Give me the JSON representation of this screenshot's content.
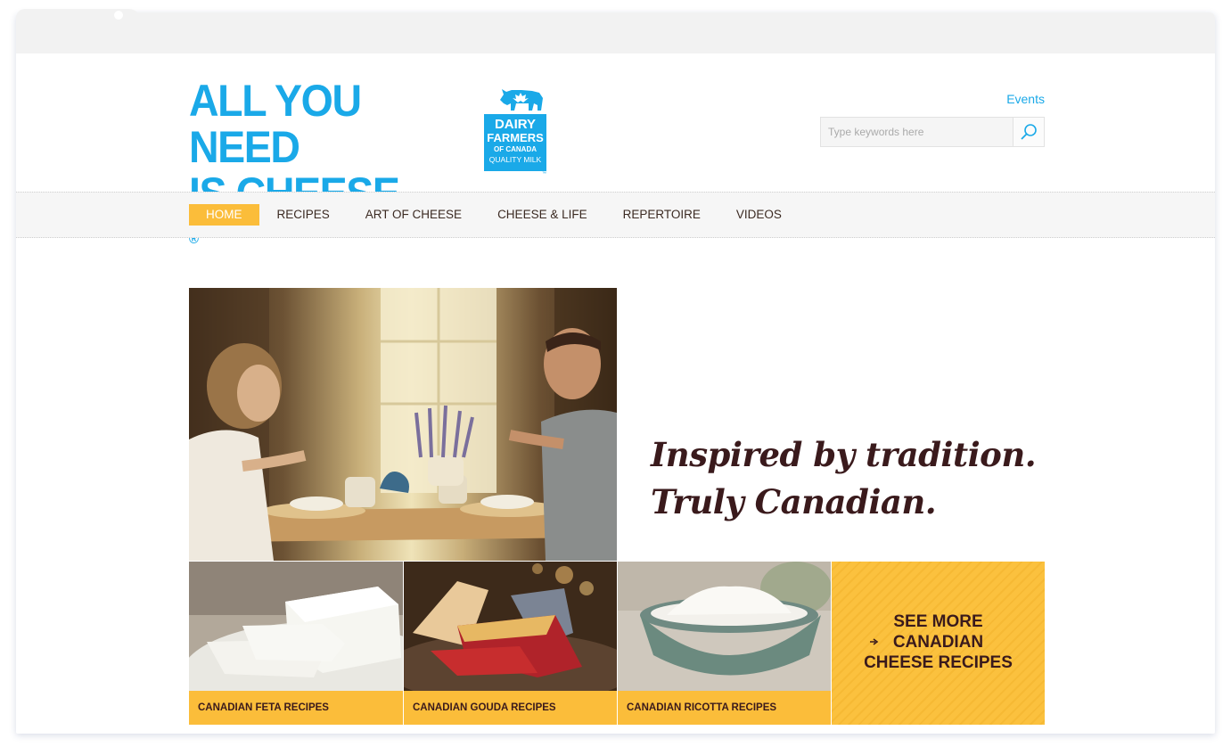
{
  "logo": {
    "line1": "ALL YOU NEED",
    "line2": "IS CHEESE",
    "registered": "®",
    "badge_line1": "DAIRY",
    "badge_line2": "FARMERS",
    "badge_line3": "OF CANADA",
    "badge_line4": "QUALITY MILK",
    "badge_tm": "™"
  },
  "header": {
    "events_link": "Events",
    "search_placeholder": "Type keywords here"
  },
  "nav": {
    "items": [
      {
        "label": "HOME",
        "active": true
      },
      {
        "label": "RECIPES",
        "active": false
      },
      {
        "label": "ART OF CHEESE",
        "active": false
      },
      {
        "label": "CHEESE & LIFE",
        "active": false
      },
      {
        "label": "REPERTOIRE",
        "active": false
      },
      {
        "label": "VIDEOS",
        "active": false
      }
    ]
  },
  "hero": {
    "tagline_line1": "Inspired by tradition.",
    "tagline_line2": "Truly Canadian."
  },
  "tiles": [
    {
      "caption": "CANADIAN FETA RECIPES"
    },
    {
      "caption": "CANADIAN GOUDA RECIPES"
    },
    {
      "caption": "CANADIAN RICOTTA RECIPES"
    }
  ],
  "more": {
    "line1": "SEE MORE",
    "line2": "CANADIAN",
    "line3": "CHEESE RECIPES"
  },
  "colors": {
    "brand_blue": "#1aa9e8",
    "accent_yellow": "#fbbd3a",
    "dark_brown": "#3a1a1c"
  }
}
